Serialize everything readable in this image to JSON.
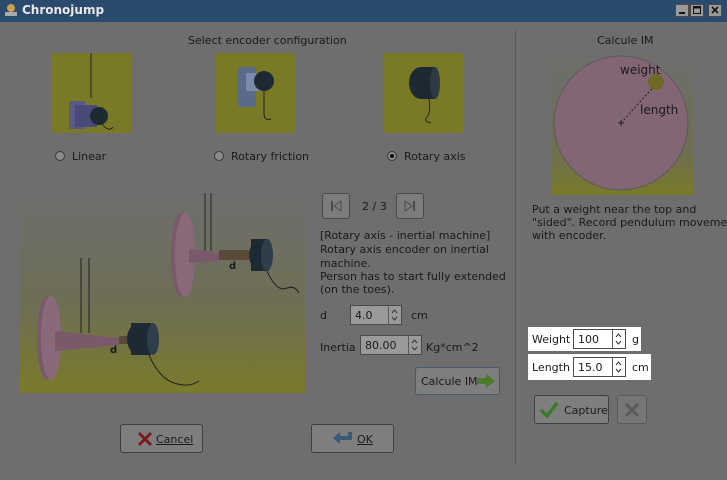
{
  "window": {
    "title": "Chronojump"
  },
  "left": {
    "heading": "Select encoder configuration",
    "options": [
      {
        "label": "Linear",
        "selected": false
      },
      {
        "label": "Rotary friction",
        "selected": false
      },
      {
        "label": "Rotary axis",
        "selected": true
      }
    ],
    "pager": {
      "text": "2 / 3"
    },
    "description": {
      "line1": "[Rotary axis - inertial machine]",
      "line2": "Rotary axis encoder on inertial",
      "line3": "machine.",
      "line4": "Person has to start fully extended",
      "line5": "(on the toes)."
    },
    "diagram": {
      "d_label_1": "d",
      "d_label_2": "d"
    },
    "d_field": {
      "label": "d",
      "value": "4.0",
      "unit": "cm"
    },
    "inertia_field": {
      "label": "Inertia",
      "value": "80.00",
      "unit": "Kg*cm^2"
    },
    "calcule_button": "Calcule IM",
    "cancel_button": "Cancel",
    "ok_button": "OK"
  },
  "right": {
    "heading": "Calcule IM",
    "diagram": {
      "weight_label": "weight",
      "length_label": "length"
    },
    "instructions": {
      "line1": "Put a weight near the top and",
      "line2": "\"sided\". Record pendulum movement",
      "line3": "with encoder."
    },
    "weight_field": {
      "label": "Weight",
      "value": "100",
      "unit": "g"
    },
    "length_field": {
      "label": "Length",
      "value": "15.0",
      "unit": "cm"
    },
    "capture_button": "Capture"
  },
  "icons": [
    "app-icon",
    "minimize-icon",
    "maximize-icon",
    "close-icon",
    "first-page-icon",
    "last-page-icon",
    "arrow-right-icon",
    "cancel-x-icon",
    "ok-arrow-icon",
    "checkmark-icon",
    "cancel-capture-icon"
  ]
}
